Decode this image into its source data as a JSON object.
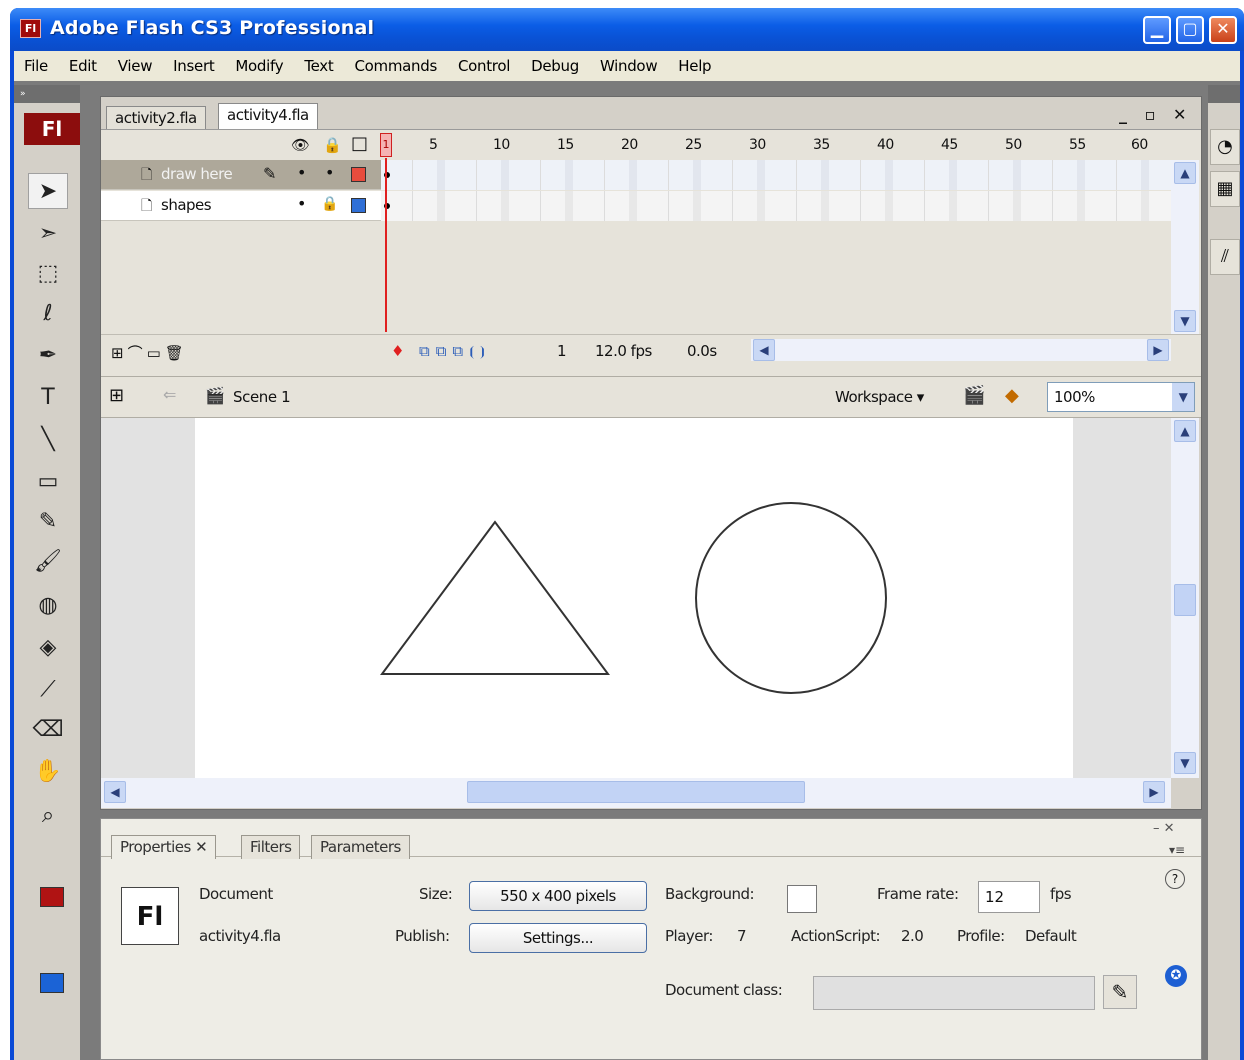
{
  "window": {
    "title": "Adobe Flash CS3 Professional",
    "app_icon_label": "Fl",
    "controls": {
      "minimize": "▁",
      "maximize": "▢",
      "close": "✕"
    }
  },
  "menubar": [
    "File",
    "Edit",
    "View",
    "Insert",
    "Modify",
    "Text",
    "Commands",
    "Control",
    "Debug",
    "Window",
    "Help"
  ],
  "tools_panel": {
    "grip_label": "»",
    "logo": "Fl",
    "tools": [
      {
        "name": "selection-tool-icon",
        "glyph": "➤",
        "selected": true
      },
      {
        "name": "subselection-tool-icon",
        "glyph": "➣"
      },
      {
        "name": "free-transform-tool-icon",
        "glyph": "⬚"
      },
      {
        "name": "lasso-tool-icon",
        "glyph": "ℓ"
      },
      {
        "name": "pen-tool-icon",
        "glyph": "✒"
      },
      {
        "name": "text-tool-icon",
        "glyph": "T"
      },
      {
        "name": "line-tool-icon",
        "glyph": "╲"
      },
      {
        "name": "rectangle-tool-icon",
        "glyph": "▭"
      },
      {
        "name": "pencil-tool-icon",
        "glyph": "✎"
      },
      {
        "name": "brush-tool-icon",
        "glyph": "🖌"
      },
      {
        "name": "ink-bottle-tool-icon",
        "glyph": "◍"
      },
      {
        "name": "paint-bucket-tool-icon",
        "glyph": "◈"
      },
      {
        "name": "eyedropper-tool-icon",
        "glyph": "⟋"
      },
      {
        "name": "eraser-tool-icon",
        "glyph": "⌫"
      },
      {
        "name": "hand-tool-icon",
        "glyph": "✋"
      },
      {
        "name": "zoom-tool-icon",
        "glyph": "⌕"
      }
    ],
    "stroke_color": "#b01313",
    "fill_color": "#1b63d6"
  },
  "document": {
    "tabs": [
      "activity2.fla",
      "activity4.fla"
    ],
    "active_tab": "activity4.fla",
    "window_controls": "_ ▫ ✕"
  },
  "timeline": {
    "header_icons": {
      "eye": "👁",
      "lock": "🔒",
      "outline": "□"
    },
    "playhead_frame": "1",
    "frame_numbers": [
      "5",
      "10",
      "15",
      "20",
      "25",
      "30",
      "35",
      "40",
      "45",
      "50",
      "55",
      "60"
    ],
    "layers": [
      {
        "name": "draw here",
        "selected": true,
        "color": "#e84c3d",
        "editing_icon": "✎"
      },
      {
        "name": "shapes",
        "selected": false,
        "color": "#2f6fd6",
        "locked": true
      }
    ],
    "footer": {
      "current_frame": "1",
      "frame_rate": "12.0 fps",
      "elapsed_time": "0.0s"
    }
  },
  "editbar": {
    "scene": "Scene 1",
    "workspace": "Workspace ▾",
    "zoom": "100%"
  },
  "stage": {
    "stroke_color": "#333333",
    "shapes": [
      "triangle",
      "circle"
    ]
  },
  "properties": {
    "tabs": [
      "Properties",
      "Filters",
      "Parameters"
    ],
    "doc_icon": "Fl",
    "document_label": "Document",
    "document_name": "activity4.fla",
    "size_label": "Size:",
    "size_button": "550 x 400 pixels",
    "publish_label": "Publish:",
    "settings_button": "Settings...",
    "background_label": "Background:",
    "background_color": "#ffffff",
    "framerate_label": "Frame rate:",
    "framerate_value": "12",
    "fps_label": "fps",
    "player_label": "Player:",
    "player_value": "7",
    "actionscript_label": "ActionScript:",
    "actionscript_value": "2.0",
    "profile_label": "Profile:",
    "profile_value": "Default",
    "docclass_label": "Document class:",
    "docclass_value": ""
  }
}
